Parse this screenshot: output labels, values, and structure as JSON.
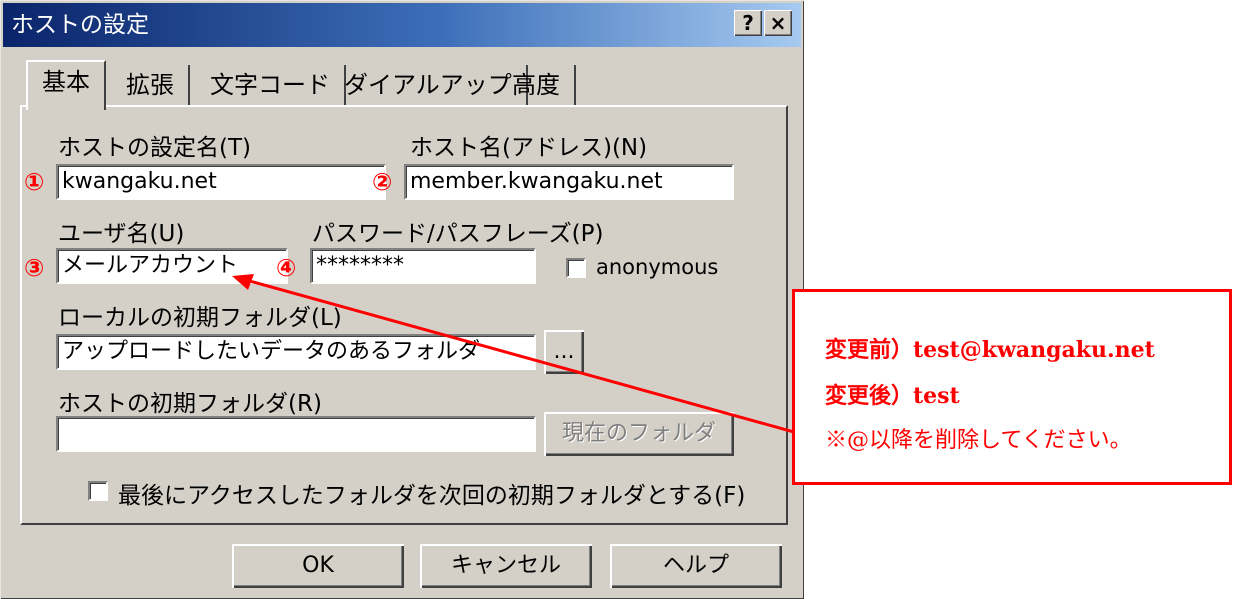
{
  "window": {
    "title": "ホストの設定",
    "help_button": "?",
    "close_button": "×"
  },
  "tabs": [
    {
      "label": "基本",
      "active": true
    },
    {
      "label": "拡張"
    },
    {
      "label": "文字コード"
    },
    {
      "label": "ダイアルアップ"
    },
    {
      "label": "高度"
    }
  ],
  "form": {
    "setting_name_label": "ホストの設定名(T)",
    "setting_name_value": "kwangaku.net",
    "host_name_label": "ホスト名(アドレス)(N)",
    "host_name_value": "member.kwangaku.net",
    "user_name_label": "ユーザ名(U)",
    "user_name_value": "メールアカウント",
    "password_label": "パスワード/パスフレーズ(P)",
    "password_value": "********",
    "anonymous_label": "anonymous",
    "local_folder_label": "ローカルの初期フォルダ(L)",
    "local_folder_value": "アップロードしたいデータのあるフォルダ",
    "browse_button": "...",
    "host_folder_label": "ホストの初期フォルダ(R)",
    "host_folder_value": "",
    "current_folder_button": "現在のフォルダ",
    "last_access_checkbox_label": "最後にアクセスしたフォルダを次回の初期フォルダとする(F)"
  },
  "markers": [
    "①",
    "②",
    "③",
    "④"
  ],
  "buttons": {
    "ok": "OK",
    "cancel": "キャンセル",
    "help": "ヘルプ"
  },
  "annotation": {
    "line1": "変更前）test@kwangaku.net",
    "line2": "変更後）test",
    "line3": "※@以降を削除してください。"
  },
  "colors": {
    "annotation": "#ff0000",
    "dialog_face": "#d4d0c8",
    "titlebar_start": "#0a246a",
    "titlebar_end": "#a6caf0"
  }
}
